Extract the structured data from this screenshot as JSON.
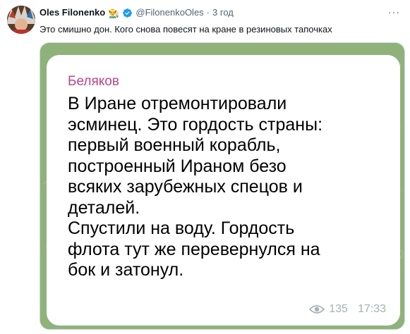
{
  "tweet": {
    "author_name": "Oles Filonenko",
    "author_emoji": "👨‍🌾",
    "handle": "@FilonenkoOles",
    "separator": "·",
    "time": "3 год",
    "more_label": "···",
    "text": "Это смишно дон. Кого снова повесят на кране в резиновых тапочках"
  },
  "message": {
    "sender": "Беляков",
    "lines": [
      "В Иране отремонтировали",
      "эсминец. Это гордость страны:",
      "первый военный корабль,",
      "построенный Ираном безо",
      "всяких зарубежных спецов и",
      "деталей.",
      "Спустили на воду. Гордость",
      "флота тут же перевернулся на",
      "бок и затонул."
    ],
    "views": "135",
    "time": "17:33"
  },
  "colors": {
    "verified": "#1d9bf0",
    "sender": "#b8468b",
    "telegram_bg": "#8fb27a",
    "meta_text": "#a7b0b6"
  },
  "icons": {
    "verified": "verified-badge-icon",
    "views": "eye-icon",
    "more": "more-icon"
  }
}
